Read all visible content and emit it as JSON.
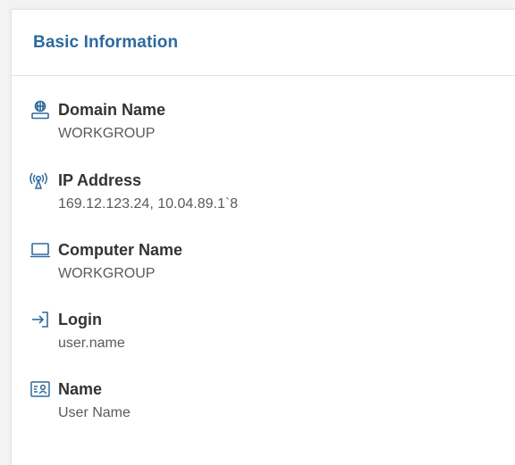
{
  "panel": {
    "title": "Basic Information",
    "accent_color": "#2e6a9e",
    "items": [
      {
        "icon": "domain-network-icon",
        "label": "Domain Name",
        "value": "WORKGROUP"
      },
      {
        "icon": "wireless-signal-icon",
        "label": "IP Address",
        "value": "169.12.123.24, 10.04.89.1`8"
      },
      {
        "icon": "laptop-icon",
        "label": "Computer Name",
        "value": "WORKGROUP"
      },
      {
        "icon": "login-arrow-icon",
        "label": "Login",
        "value": "user.name"
      },
      {
        "icon": "id-card-icon",
        "label": "Name",
        "value": "User Name"
      }
    ]
  }
}
